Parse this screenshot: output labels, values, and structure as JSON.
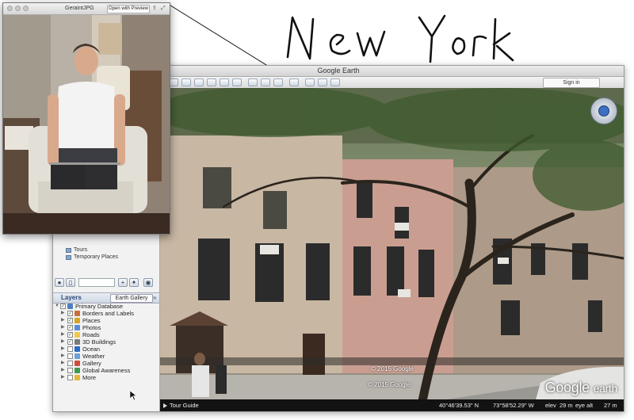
{
  "annotation": {
    "handwritten_text": "New York"
  },
  "preview": {
    "filename": "GeraintJPG",
    "open_button": "Open with Preview"
  },
  "earth": {
    "window_title": "Google Earth",
    "sign_in": "Sign in",
    "sidebar": {
      "places_items": [
        "Tours",
        "Temporary Places"
      ],
      "layers_title": "Layers",
      "earth_gallery": "Earth Gallery",
      "layers": [
        {
          "label": "Primary Database",
          "icon": "database-icon",
          "color": "#4e7fc2",
          "root": true,
          "checked": true
        },
        {
          "label": "Borders and Labels",
          "icon": "borders-icon",
          "color": "#c86f3a",
          "root": false,
          "checked": true
        },
        {
          "label": "Places",
          "icon": "places-icon",
          "color": "#d9a323",
          "root": false,
          "checked": true
        },
        {
          "label": "Photos",
          "icon": "photos-icon",
          "color": "#5a8dd6",
          "root": false,
          "checked": true
        },
        {
          "label": "Roads",
          "icon": "roads-icon",
          "color": "#f1c743",
          "root": false,
          "checked": true
        },
        {
          "label": "3D Buildings",
          "icon": "buildings-icon",
          "color": "#7a7a7a",
          "root": false,
          "checked": true
        },
        {
          "label": "Ocean",
          "icon": "ocean-icon",
          "color": "#2b6cc4",
          "root": false,
          "checked": false
        },
        {
          "label": "Weather",
          "icon": "weather-icon",
          "color": "#6fa0d8",
          "root": false,
          "checked": false
        },
        {
          "label": "Gallery",
          "icon": "gallery-icon",
          "color": "#d24c3b",
          "root": false,
          "checked": false
        },
        {
          "label": "Global Awareness",
          "icon": "global-awareness-icon",
          "color": "#3d9a4c",
          "root": false,
          "checked": false
        },
        {
          "label": "More",
          "icon": "more-icon",
          "color": "#e3b73a",
          "root": false,
          "checked": false
        }
      ]
    },
    "credits": [
      "© 2015 Google",
      "© 2015 Google"
    ],
    "logo": {
      "main": "Google",
      "sub": "earth"
    },
    "status": {
      "tour_guide": "Tour Guide",
      "lat": "40°46'39.53\" N",
      "lon": "73°58'52.29\" W",
      "elev_label": "elev",
      "elev_value": "29 m",
      "eye_label": "eye alt",
      "eye_value": "27 m"
    }
  }
}
